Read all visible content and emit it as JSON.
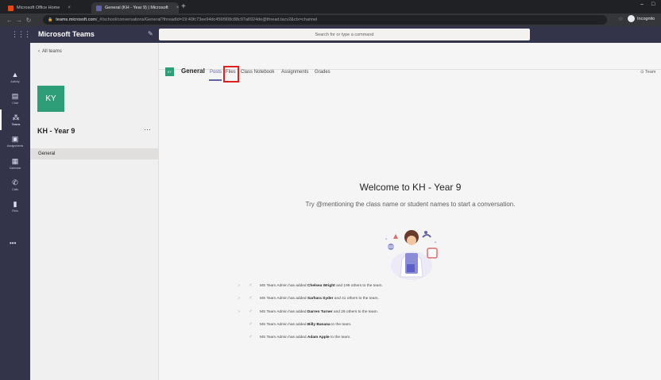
{
  "browser": {
    "tabs": [
      {
        "title": "Microsoft Office Home",
        "active": false,
        "favicon_color": "#e8490f"
      },
      {
        "title": "General (KH - Year 9) | Microsoft",
        "active": true,
        "favicon_color": "#6264a7"
      }
    ],
    "new_tab_glyph": "+",
    "close_glyph": "×",
    "window_controls": [
      "–",
      "□"
    ],
    "url_host": "teams.microsoft.com",
    "url_path": "/_#/school/conversations/General?threadId=19:40fc73ee94dc456f908c88c97a6924de@thread.tacv2&ctx=channel",
    "profile_label": "Incognito"
  },
  "teams": {
    "app_title": "Microsoft Teams",
    "search_placeholder": "Search for or type a command",
    "accent_color": "#6264a7",
    "rail": [
      {
        "label": "Activity",
        "icon": "bell-icon",
        "glyph": "🔔"
      },
      {
        "label": "Chat",
        "icon": "chat-icon",
        "glyph": "▤"
      },
      {
        "label": "Teams",
        "icon": "teams-icon",
        "glyph": "⁂",
        "active": true
      },
      {
        "label": "Assignments",
        "icon": "assignments-icon",
        "glyph": "▣"
      },
      {
        "label": "Calendar",
        "icon": "calendar-icon",
        "glyph": "▦"
      },
      {
        "label": "Calls",
        "icon": "phone-icon",
        "glyph": "✆"
      },
      {
        "label": "Files",
        "icon": "file-icon",
        "glyph": "▮"
      }
    ],
    "rail_more": "•••"
  },
  "left_panel": {
    "back_label": "All teams",
    "avatar_initials": "KY",
    "team_name": "KH - Year 9",
    "more": "···",
    "channels": [
      "General"
    ]
  },
  "channel": {
    "icon_text": "KY",
    "name": "General",
    "tabs": [
      "Posts",
      "Files",
      "Class Notebook",
      "Assignments",
      "Grades"
    ],
    "active_tab": "Posts",
    "highlighted_tab": "Files",
    "team_link": "⊙ Team"
  },
  "welcome": {
    "title": "Welcome to KH - Year 9",
    "subtitle": "Try @mentioning the class name or student names to start a conversation."
  },
  "activity": [
    {
      "expand": true,
      "actor": "MS Team Admin",
      "verb": " has added ",
      "target": "Chelsea Wright",
      "rest": " and 199 others to the team."
    },
    {
      "expand": true,
      "actor": "MS Team Admin",
      "verb": " has added ",
      "target": "Sarhara Syder",
      "rest": " and 41 others to the team."
    },
    {
      "expand": true,
      "actor": "MS Team Admin",
      "verb": " has added ",
      "target": "Darren Turner",
      "rest": " and 29 others to the team."
    },
    {
      "expand": false,
      "actor": "MS Team Admin",
      "verb": " has added ",
      "target": "Billy Banana",
      "rest": " to the team."
    },
    {
      "expand": false,
      "actor": "MS Team Admin",
      "verb": " has added ",
      "target": "Adam Apple",
      "rest": " to the team."
    }
  ],
  "activity_icon": "user-add-icon",
  "expand_glyph": "›"
}
